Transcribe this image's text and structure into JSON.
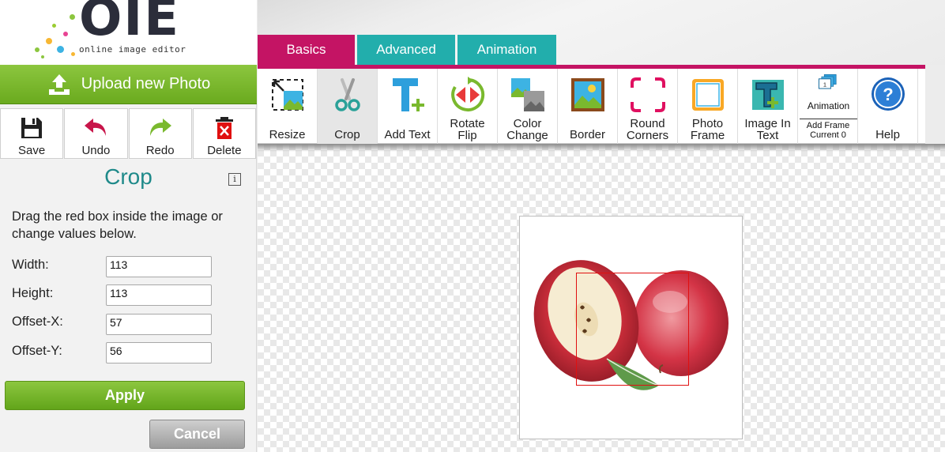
{
  "logo": {
    "letters": "OIE",
    "tagline": "online image editor"
  },
  "upload": {
    "label": "Upload new Photo"
  },
  "actions": [
    {
      "label": "Save",
      "icon": "save-icon"
    },
    {
      "label": "Undo",
      "icon": "undo-icon"
    },
    {
      "label": "Redo",
      "icon": "redo-icon"
    },
    {
      "label": "Delete",
      "icon": "delete-icon"
    }
  ],
  "panel": {
    "title": "Crop",
    "info_icon": "i",
    "instructions": "Drag the red box inside the image or change values below.",
    "fields": {
      "width": {
        "label": "Width:",
        "value": "113"
      },
      "height": {
        "label": "Height:",
        "value": "113"
      },
      "offset_x": {
        "label": "Offset-X:",
        "value": "57"
      },
      "offset_y": {
        "label": "Offset-Y:",
        "value": "56"
      }
    },
    "apply_label": "Apply",
    "cancel_label": "Cancel"
  },
  "tabs": [
    "Basics",
    "Advanced",
    "Animation"
  ],
  "tools": [
    {
      "label": "Resize",
      "icon": "resize-icon"
    },
    {
      "label": "Crop",
      "icon": "scissors-icon"
    },
    {
      "label": "Add Text",
      "icon": "add-text-icon"
    },
    {
      "label": "Rotate Flip",
      "line1": "Rotate",
      "line2": "Flip",
      "icon": "rotate-flip-icon"
    },
    {
      "label": "Color Change",
      "line1": "Color",
      "line2": "Change",
      "icon": "color-change-icon"
    },
    {
      "label": "Border",
      "icon": "border-icon"
    },
    {
      "label": "Round Corners",
      "line1": "Round",
      "line2": "Corners",
      "icon": "round-corners-icon"
    },
    {
      "label": "Photo Frame",
      "line1": "Photo",
      "line2": "Frame",
      "icon": "photo-frame-icon"
    },
    {
      "label": "Image In Text",
      "line1": "Image In",
      "line2": "Text",
      "icon": "image-in-text-icon"
    },
    {
      "label": "Animation",
      "sub1": "Add Frame",
      "sub2": "Current 0",
      "icon": "animation-frames-icon"
    },
    {
      "label": "Help",
      "icon": "help-icon"
    }
  ],
  "colors": {
    "brand_green": "#7ab92e",
    "tab_active": "#c41464",
    "tab_inactive": "#22aeac",
    "title_teal": "#1f8a8a",
    "crop_box": "#e01010"
  },
  "canvas": {
    "image": "apple-photo"
  }
}
